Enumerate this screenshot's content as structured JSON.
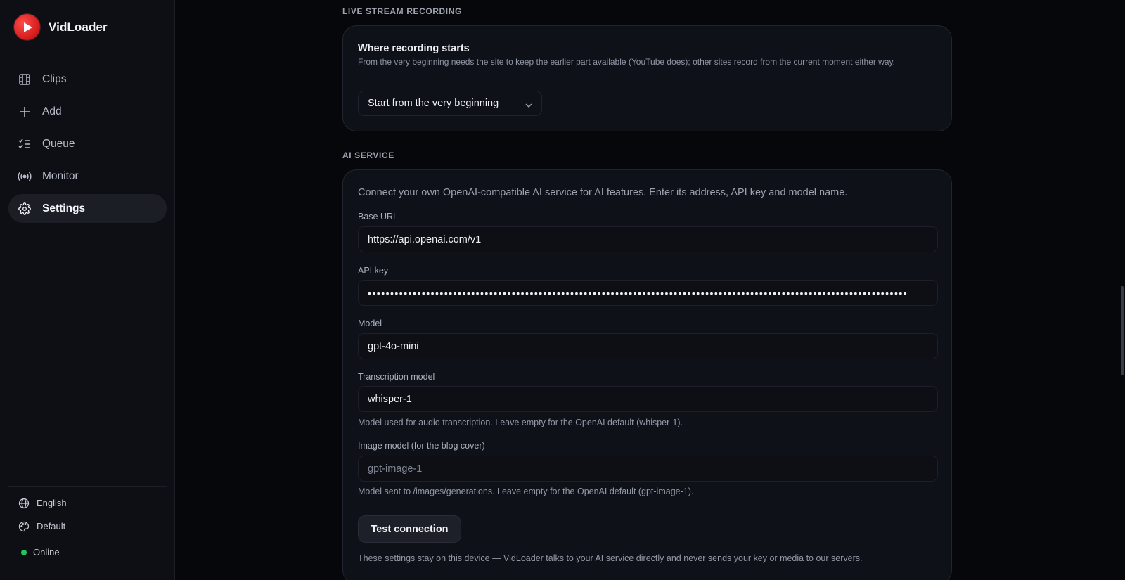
{
  "app": {
    "name": "VidLoader"
  },
  "sidebar": {
    "items": [
      {
        "label": "Clips",
        "icon": "film-icon",
        "active": false
      },
      {
        "label": "Add",
        "icon": "plus-icon",
        "active": false
      },
      {
        "label": "Queue",
        "icon": "list-check-icon",
        "active": false
      },
      {
        "label": "Monitor",
        "icon": "broadcast-icon",
        "active": false
      },
      {
        "label": "Settings",
        "icon": "gear-icon",
        "active": true
      }
    ],
    "language": "English",
    "theme": "Default",
    "status": "Online"
  },
  "live_stream": {
    "section_title": "LIVE STREAM RECORDING",
    "setting_title": "Where recording starts",
    "setting_desc": "From the very beginning needs the site to keep the earlier part available (YouTube does); other sites record from the current moment either way.",
    "selected_option": "Start from the very beginning"
  },
  "ai_service": {
    "section_title": "AI SERVICE",
    "intro": "Connect your own OpenAI-compatible AI service for AI features. Enter its address, API key and model name.",
    "base_url_label": "Base URL",
    "base_url_value": "https://api.openai.com/v1",
    "api_key_label": "API key",
    "api_key_value": "••••••••••••••••••••••••••••••••••••••••••••••••••••••••••••••••••••••••••••••••••••••••••••••••••••••••••••••••••••••••",
    "model_label": "Model",
    "model_value": "gpt-4o-mini",
    "transcription_label": "Transcription model",
    "transcription_value": "whisper-1",
    "transcription_hint": "Model used for audio transcription. Leave empty for the OpenAI default (whisper-1).",
    "image_label": "Image model (for the blog cover)",
    "image_placeholder": "gpt-image-1",
    "image_hint": "Model sent to /images/generations. Leave empty for the OpenAI default (gpt-image-1).",
    "test_button": "Test connection",
    "footer_note": "These settings stay on this device — VidLoader talks to your AI service directly and never sends your key or media to our servers."
  },
  "colors": {
    "accent": "#d11a1a",
    "online": "#22c55e",
    "background": "#06070b",
    "card": "#0f1118"
  }
}
